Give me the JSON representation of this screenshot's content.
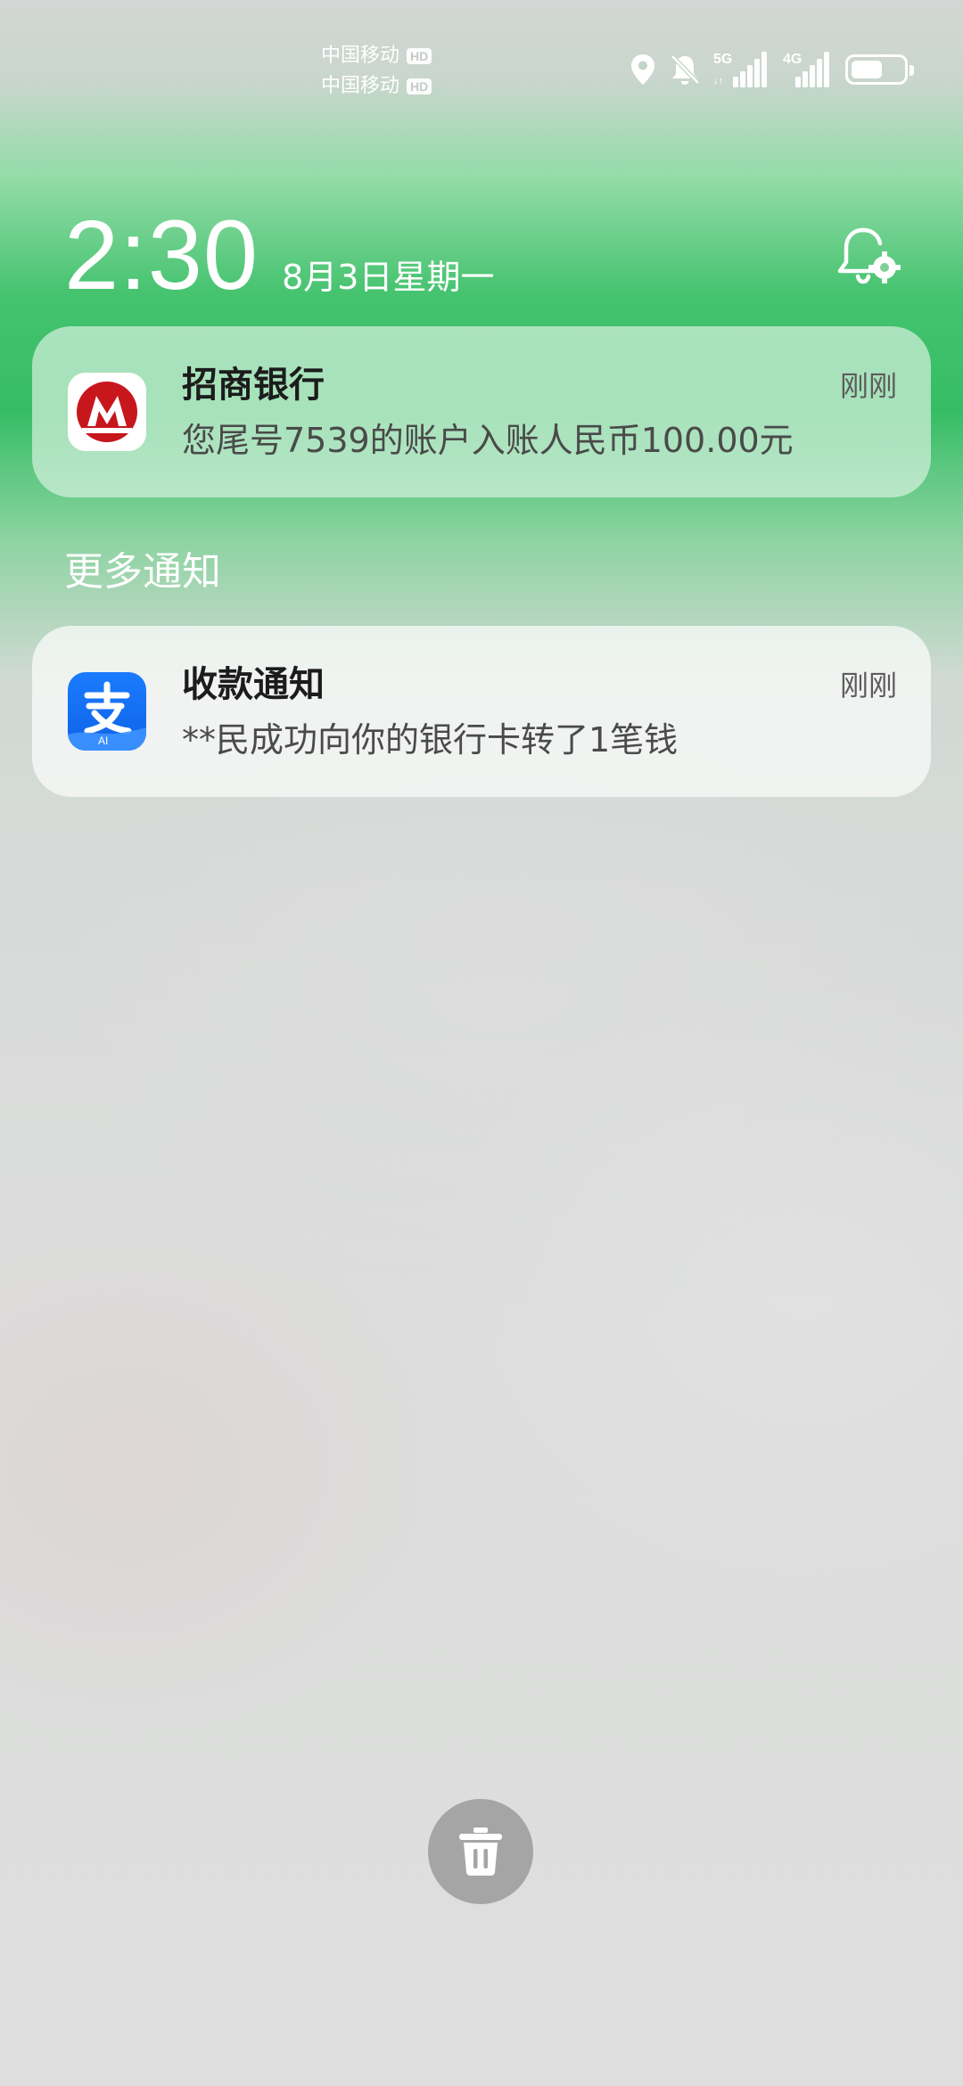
{
  "status_bar": {
    "carriers": [
      {
        "name": "中国移动",
        "badge": "HD"
      },
      {
        "name": "中国移动",
        "badge": "HD"
      }
    ],
    "signals": [
      {
        "label": "5G",
        "bars": 5
      },
      {
        "label": "4G",
        "bars": 5
      }
    ],
    "battery_level": 0.6,
    "icons": [
      "location-icon",
      "bell-muted-icon",
      "signal-5g-icon",
      "signal-4g-icon",
      "battery-icon"
    ]
  },
  "clock": {
    "time": "2:30",
    "date": "8月3日星期一"
  },
  "notifications": [
    {
      "app": "招商银行",
      "icon": "cmb-bank-logo-icon",
      "time": "刚刚",
      "body": "您尾号7539的账户入账人民币100.00元",
      "accent": "#c8161d"
    }
  ],
  "more_section": {
    "label": "更多通知",
    "items": [
      {
        "app": "收款通知",
        "icon": "alipay-logo-icon",
        "time": "刚刚",
        "body": "**民成功向你的银行卡转了1笔钱",
        "accent": "#1677ff",
        "icon_badge": "AI"
      }
    ]
  },
  "clear_button": {
    "icon": "trash-icon"
  }
}
